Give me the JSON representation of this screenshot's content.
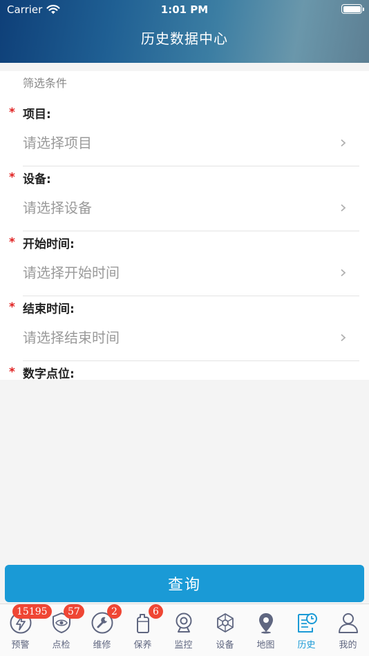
{
  "status_bar": {
    "carrier": "Carrier",
    "time": "1:01 PM"
  },
  "nav": {
    "title": "历史数据中心"
  },
  "form": {
    "section_title": "筛选条件",
    "required_mark": "*",
    "fields": [
      {
        "label": "项目:",
        "placeholder": "请选择项目"
      },
      {
        "label": "设备:",
        "placeholder": "请选择设备"
      },
      {
        "label": "开始时间:",
        "placeholder": "请选择开始时间"
      },
      {
        "label": "结束时间:",
        "placeholder": "请选择结束时间"
      },
      {
        "label": "数字点位:"
      }
    ]
  },
  "query_button": {
    "label": "查询"
  },
  "tabbar": {
    "active": "历史",
    "accent_color": "#1a9ad6",
    "badge_color": "#ef4634",
    "items": [
      {
        "label": "预警",
        "icon": "lightning-icon",
        "badge": "15195"
      },
      {
        "label": "点检",
        "icon": "eye-shield-icon",
        "badge": "57"
      },
      {
        "label": "维修",
        "icon": "wrench-icon",
        "badge": "2"
      },
      {
        "label": "保养",
        "icon": "oil-can-icon",
        "badge": "6"
      },
      {
        "label": "监控",
        "icon": "webcam-icon"
      },
      {
        "label": "设备",
        "icon": "network-icon"
      },
      {
        "label": "地图",
        "icon": "map-pin-icon"
      },
      {
        "label": "历史",
        "icon": "history-document-icon"
      },
      {
        "label": "我的",
        "icon": "user-icon"
      }
    ]
  }
}
